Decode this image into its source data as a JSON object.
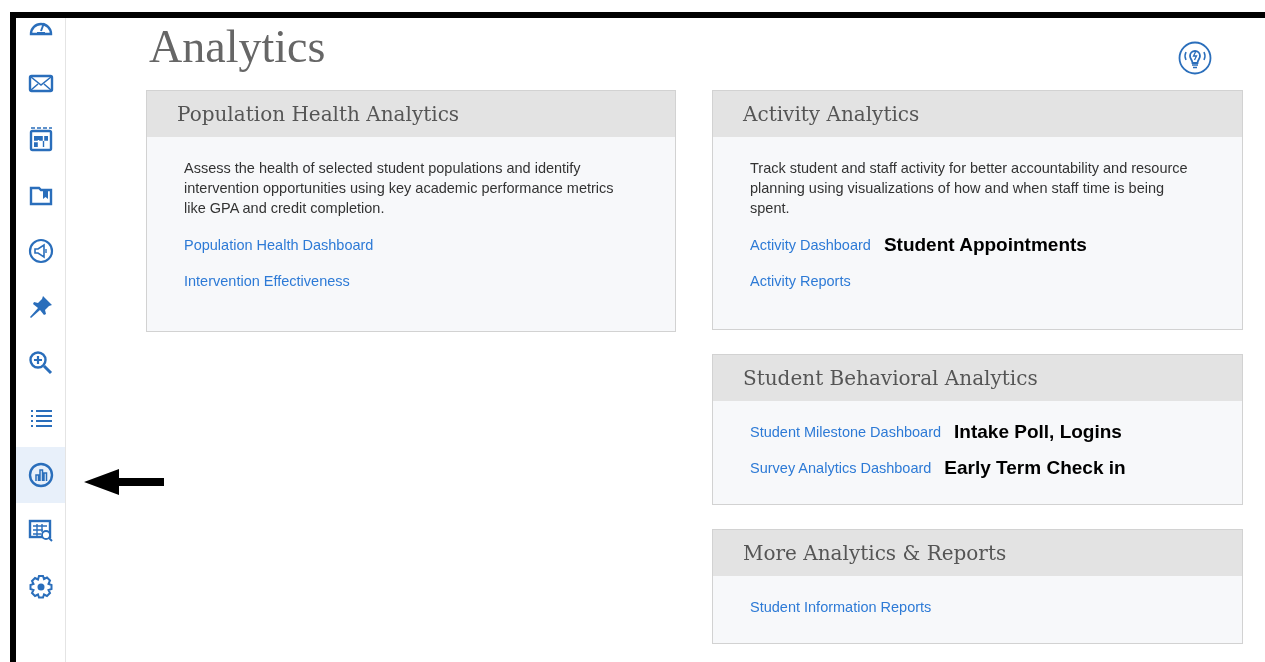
{
  "sidebar": {
    "items": [
      {
        "selected": false
      },
      {
        "selected": false
      },
      {
        "selected": false
      },
      {
        "selected": false
      },
      {
        "selected": false
      },
      {
        "selected": false
      },
      {
        "selected": false
      },
      {
        "selected": false
      },
      {
        "selected": true
      },
      {
        "selected": false
      },
      {
        "selected": false
      }
    ]
  },
  "page": {
    "title": "Analytics"
  },
  "columns": [
    [
      {
        "title": "Population Health Analytics",
        "description": "Assess the health of selected student populations and identify intervention opportunities using key academic performance metrics like GPA and credit completion.",
        "links": [
          {
            "label": "Population Health Dashboard"
          },
          {
            "label": "Intervention Effectiveness"
          }
        ]
      }
    ],
    [
      {
        "title": "Activity Analytics",
        "description": "Track student and staff activity for better accountability and resource planning using visualizations of how and when staff time is being spent.",
        "links": [
          {
            "label": "Activity Dashboard",
            "note": "Student Appointments"
          },
          {
            "label": "Activity Reports"
          }
        ]
      },
      {
        "title": "Student Behavioral Analytics",
        "links": [
          {
            "label": "Student Milestone Dashboard",
            "note": "Intake Poll, Logins"
          },
          {
            "label": "Survey Analytics Dashboard",
            "note": "Early Term Check in"
          }
        ]
      },
      {
        "title": "More Analytics & Reports",
        "links": [
          {
            "label": "Student Information Reports"
          }
        ]
      }
    ]
  ]
}
